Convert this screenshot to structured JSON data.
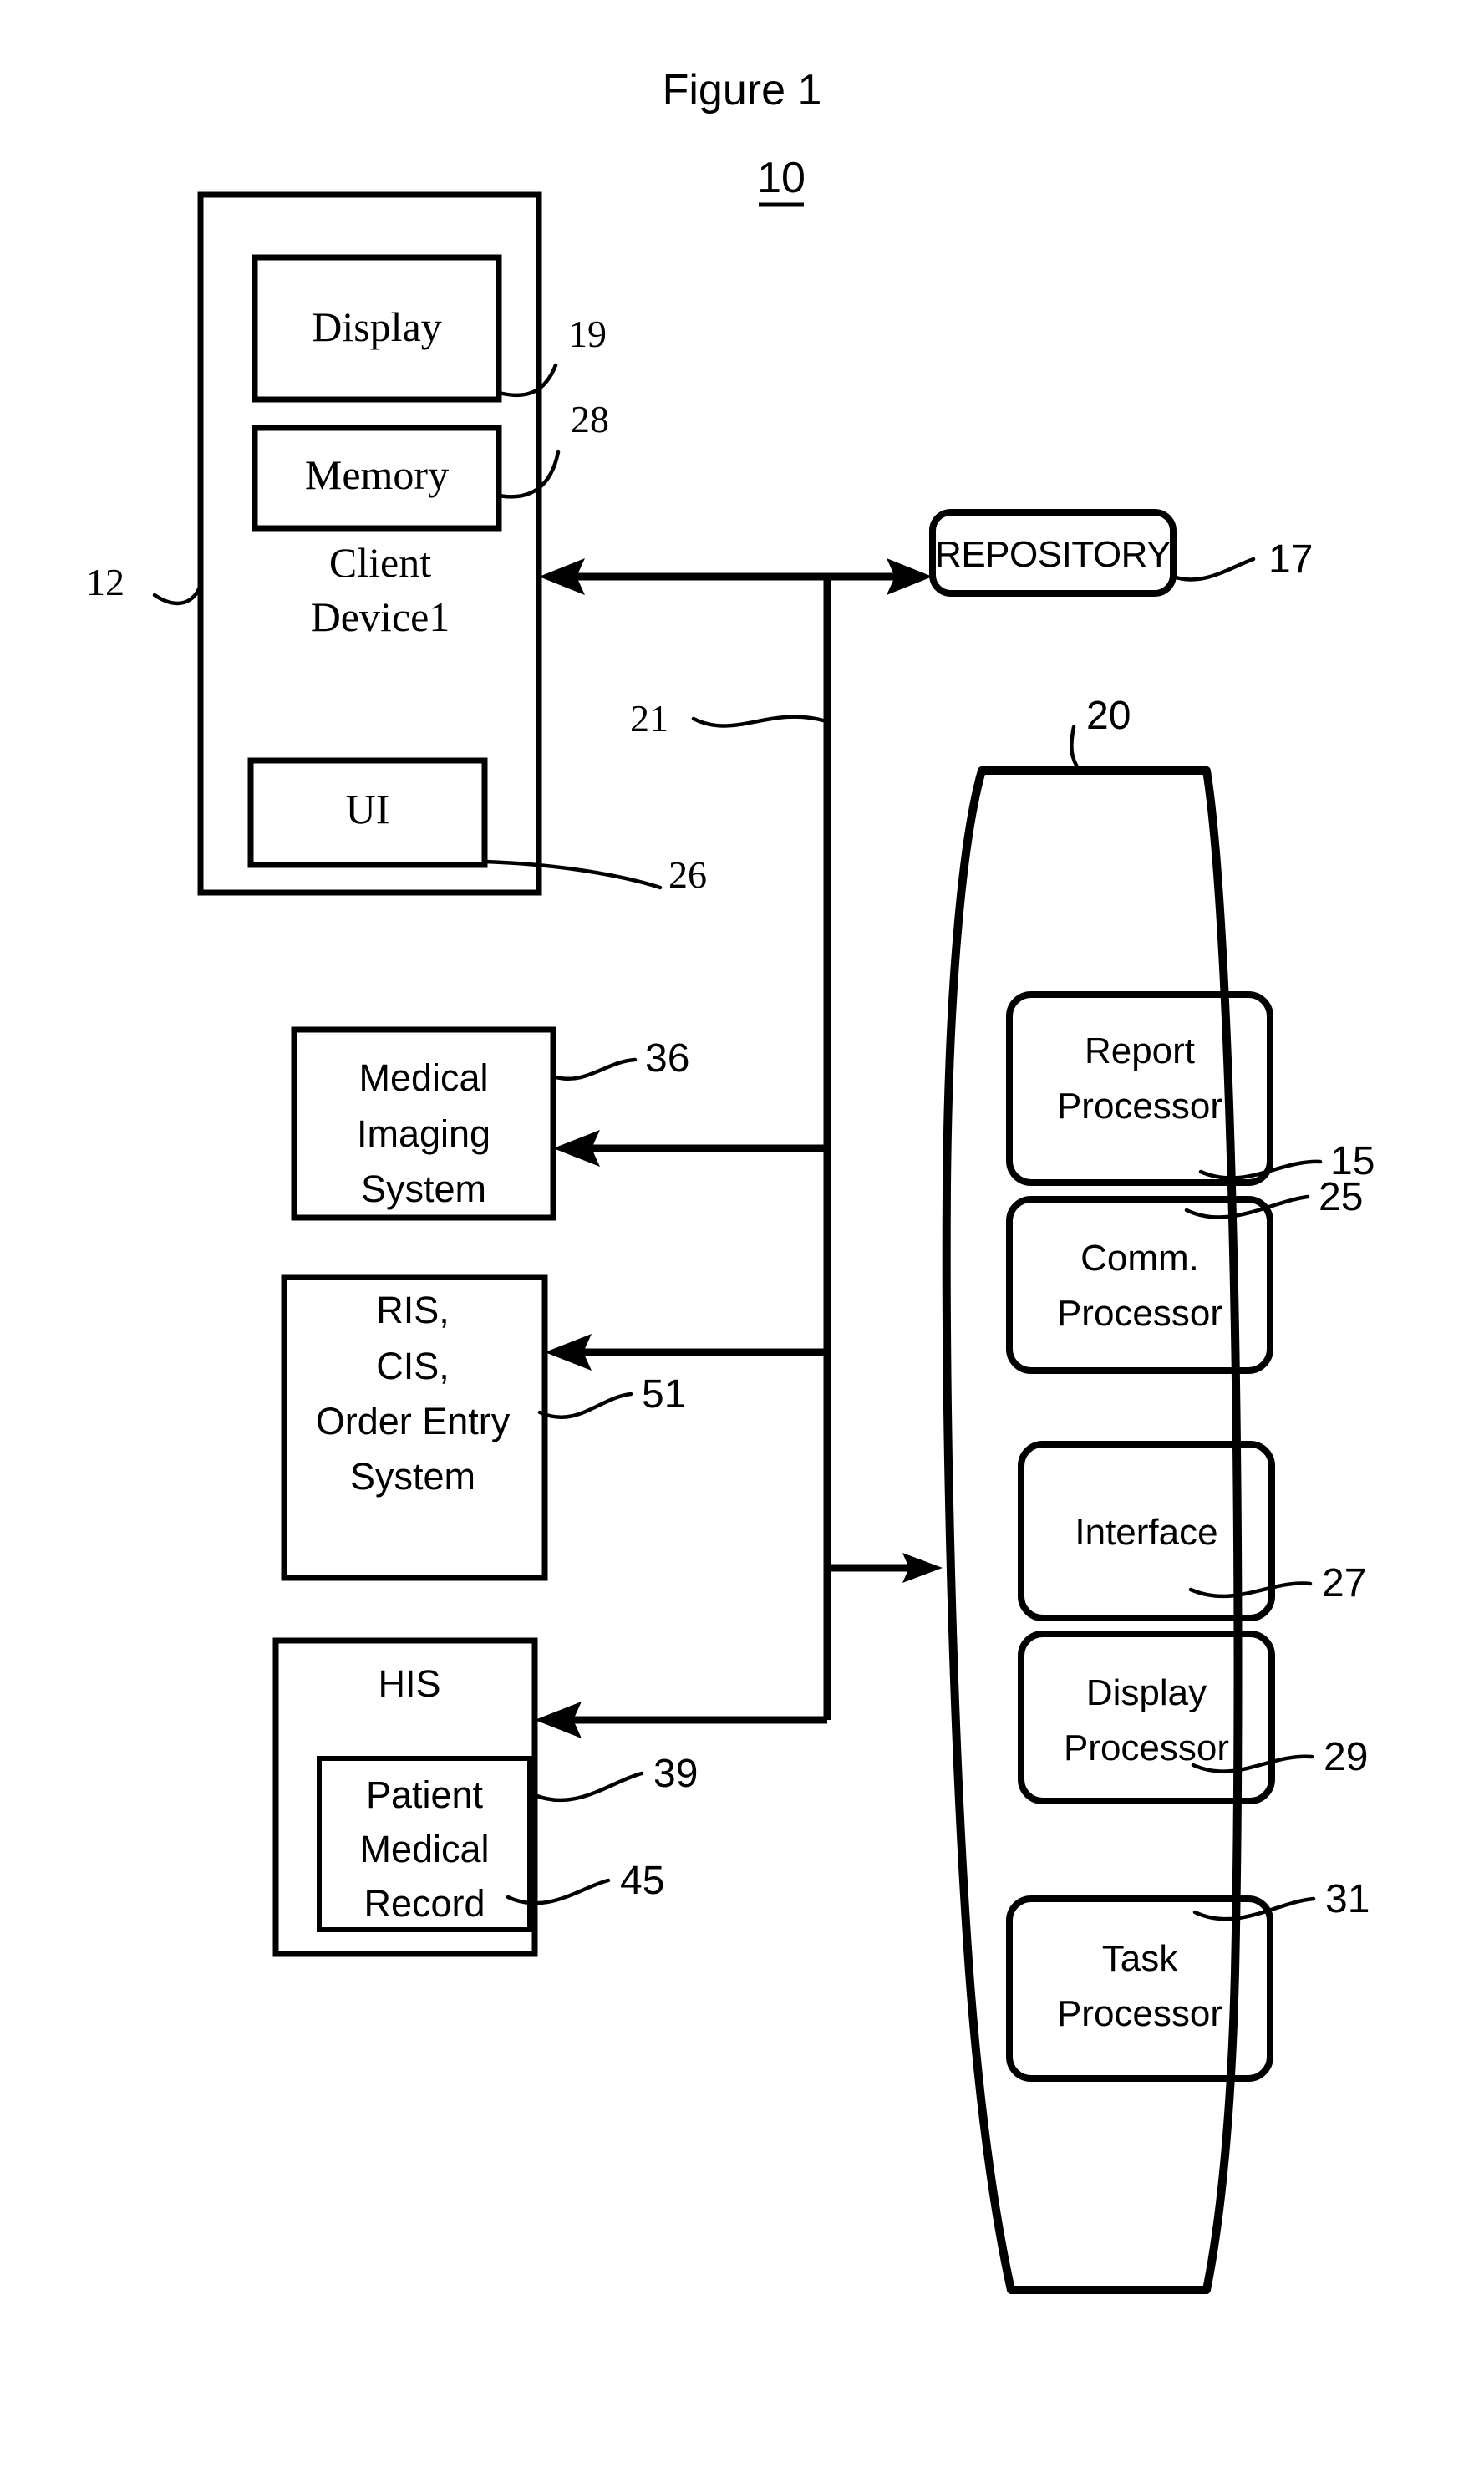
{
  "figure": {
    "title": "Figure 1",
    "system_ref": "10"
  },
  "client_device": {
    "label_line1": "Client",
    "label_line2": "Device1",
    "ref": "12",
    "display": {
      "label": "Display",
      "ref": "19"
    },
    "memory": {
      "label": "Memory",
      "ref": "28"
    },
    "ui": {
      "label": "UI",
      "ref": "26"
    }
  },
  "repository": {
    "label": "REPOSITORY",
    "ref": "17"
  },
  "bus": {
    "ref": "21"
  },
  "medical_imaging": {
    "line1": "Medical",
    "line2": "Imaging",
    "line3": "System",
    "ref": "36"
  },
  "order_entry": {
    "line1": "RIS,",
    "line2": "CIS,",
    "line3": "Order Entry",
    "line4": "System",
    "ref": "51"
  },
  "his": {
    "label": "HIS",
    "ref": "39",
    "patient_record": {
      "line1": "Patient",
      "line2": "Medical",
      "line3": "Record",
      "ref": "45"
    }
  },
  "server": {
    "ref": "20",
    "processors": [
      {
        "line1": "Report",
        "line2": "Processor",
        "ref": "15"
      },
      {
        "line1": "Comm.",
        "line2": "Processor",
        "ref": "25"
      },
      {
        "line1": "Interface",
        "line2": "",
        "ref": "27"
      },
      {
        "line1": "Display",
        "line2": "Processor",
        "ref": "29"
      },
      {
        "line1": "Task",
        "line2": "Processor",
        "ref": "31"
      }
    ]
  },
  "colors": {
    "ink": "#000000",
    "paper": "#ffffff"
  }
}
